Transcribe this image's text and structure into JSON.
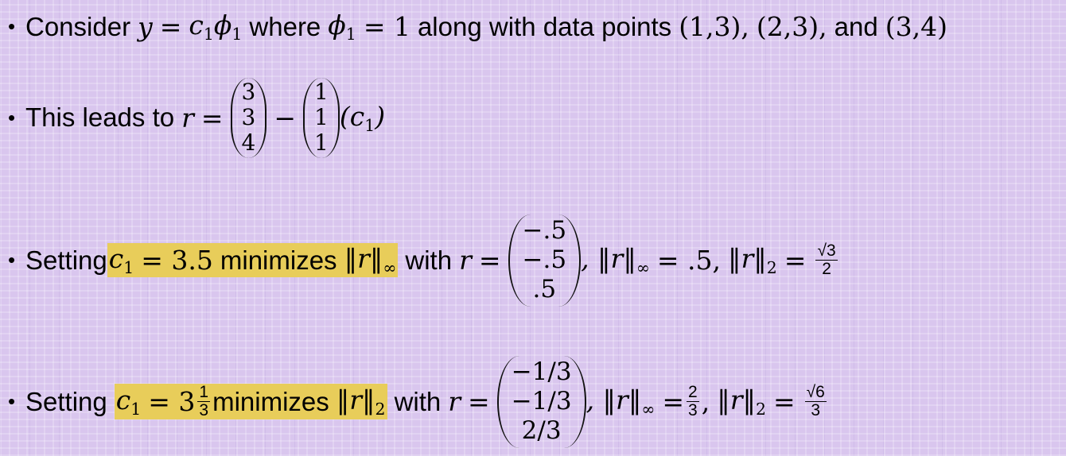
{
  "line1": {
    "t1": "Consider",
    "y": "y",
    "eq": "=",
    "c": "c",
    "one": "1",
    "phi": "ϕ",
    "t2": "where",
    "t3": "= 1",
    "t4": "along with data points",
    "p1": "(1,3),",
    "p2": "(2,3),",
    "t5": "and",
    "p3": "(3,4)"
  },
  "line2": {
    "t1": "This leads to",
    "r": "r",
    "eq": "=",
    "v1": [
      "3",
      "3",
      "4"
    ],
    "minus": "−",
    "v2": [
      "1",
      "1",
      "1"
    ],
    "c1": "(c",
    "c1sub": "1",
    "c1close": ")"
  },
  "line3": {
    "t1": "Setting",
    "hl_c": "c",
    "hl_sub": "1",
    "hl_eq": "= 3.5",
    "hl_t": "minimizes",
    "hl_norm": "‖r‖",
    "hl_normsub": "∞",
    "t2": "with",
    "r": "r",
    "eq": "=",
    "vec": [
      "−.5",
      "−.5",
      ".5"
    ],
    "n1": ", ‖r‖",
    "n1sub": "∞",
    "n1val": "= .5,",
    "n2": "‖r‖",
    "n2sub": "2",
    "n2eq": "=",
    "fnum": "√3",
    "fden": "2"
  },
  "line4": {
    "t1": "Setting",
    "hl_c": "c",
    "hl_sub": "1",
    "hl_eq": "= 3",
    "hl_fnum": "1",
    "hl_fden": "3",
    "hl_t": "minimizes",
    "hl_norm": "‖r‖",
    "hl_normsub": "2",
    "t2": "with",
    "r": "r",
    "eq": "=",
    "vec": [
      "−1/3",
      "−1/3",
      "2/3"
    ],
    "n1": ", ‖r‖",
    "n1sub": "∞",
    "n1eq": "=",
    "f1num": "2",
    "f1den": "3",
    "comma": ",",
    "n2": "‖r‖",
    "n2sub": "2",
    "n2eq": "=",
    "f2num": "√6",
    "f2den": "3"
  }
}
